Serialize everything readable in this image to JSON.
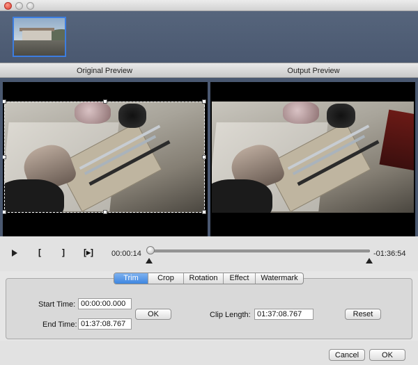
{
  "window": {
    "controls": [
      "close",
      "minimize",
      "maximize"
    ]
  },
  "thumbnails": [
    {
      "name": "clip-thumbnail",
      "selected": true
    }
  ],
  "preview": {
    "original_label": "Original Preview",
    "output_label": "Output Preview"
  },
  "playback": {
    "play_icon": "play-icon",
    "mark_in_label": "[",
    "mark_out_label": "]",
    "preview_segment_label": "[▸]",
    "current_time": "00:00:14",
    "remaining_time": "-01:36:54",
    "progress_fraction": 0.004
  },
  "tabs": [
    {
      "label": "Trim",
      "active": true
    },
    {
      "label": "Crop",
      "active": false
    },
    {
      "label": "Rotation",
      "active": false
    },
    {
      "label": "Effect",
      "active": false
    },
    {
      "label": "Watermark",
      "active": false
    }
  ],
  "trim": {
    "start_label": "Start Time:",
    "start_value": "00:00:00.000",
    "end_label": "End Time:",
    "end_value": "01:37:08.767",
    "ok_label": "OK",
    "clip_length_label": "Clip Length:",
    "clip_length_value": "01:37:08.767",
    "reset_label": "Reset"
  },
  "footer": {
    "cancel_label": "Cancel",
    "ok_label": "OK"
  },
  "colors": {
    "accent": "#3e86e0",
    "header_bg": "#4a5870"
  }
}
